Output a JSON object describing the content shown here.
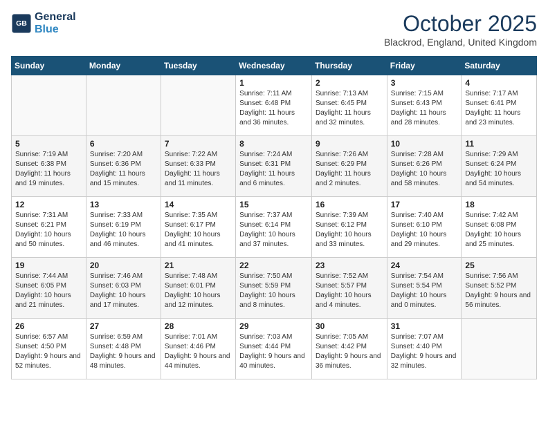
{
  "header": {
    "logo_line1": "General",
    "logo_line2": "Blue",
    "month": "October 2025",
    "location": "Blackrod, England, United Kingdom"
  },
  "days_of_week": [
    "Sunday",
    "Monday",
    "Tuesday",
    "Wednesday",
    "Thursday",
    "Friday",
    "Saturday"
  ],
  "weeks": [
    [
      {
        "num": "",
        "info": ""
      },
      {
        "num": "",
        "info": ""
      },
      {
        "num": "",
        "info": ""
      },
      {
        "num": "1",
        "info": "Sunrise: 7:11 AM\nSunset: 6:48 PM\nDaylight: 11 hours and 36 minutes."
      },
      {
        "num": "2",
        "info": "Sunrise: 7:13 AM\nSunset: 6:45 PM\nDaylight: 11 hours and 32 minutes."
      },
      {
        "num": "3",
        "info": "Sunrise: 7:15 AM\nSunset: 6:43 PM\nDaylight: 11 hours and 28 minutes."
      },
      {
        "num": "4",
        "info": "Sunrise: 7:17 AM\nSunset: 6:41 PM\nDaylight: 11 hours and 23 minutes."
      }
    ],
    [
      {
        "num": "5",
        "info": "Sunrise: 7:19 AM\nSunset: 6:38 PM\nDaylight: 11 hours and 19 minutes."
      },
      {
        "num": "6",
        "info": "Sunrise: 7:20 AM\nSunset: 6:36 PM\nDaylight: 11 hours and 15 minutes."
      },
      {
        "num": "7",
        "info": "Sunrise: 7:22 AM\nSunset: 6:33 PM\nDaylight: 11 hours and 11 minutes."
      },
      {
        "num": "8",
        "info": "Sunrise: 7:24 AM\nSunset: 6:31 PM\nDaylight: 11 hours and 6 minutes."
      },
      {
        "num": "9",
        "info": "Sunrise: 7:26 AM\nSunset: 6:29 PM\nDaylight: 11 hours and 2 minutes."
      },
      {
        "num": "10",
        "info": "Sunrise: 7:28 AM\nSunset: 6:26 PM\nDaylight: 10 hours and 58 minutes."
      },
      {
        "num": "11",
        "info": "Sunrise: 7:29 AM\nSunset: 6:24 PM\nDaylight: 10 hours and 54 minutes."
      }
    ],
    [
      {
        "num": "12",
        "info": "Sunrise: 7:31 AM\nSunset: 6:21 PM\nDaylight: 10 hours and 50 minutes."
      },
      {
        "num": "13",
        "info": "Sunrise: 7:33 AM\nSunset: 6:19 PM\nDaylight: 10 hours and 46 minutes."
      },
      {
        "num": "14",
        "info": "Sunrise: 7:35 AM\nSunset: 6:17 PM\nDaylight: 10 hours and 41 minutes."
      },
      {
        "num": "15",
        "info": "Sunrise: 7:37 AM\nSunset: 6:14 PM\nDaylight: 10 hours and 37 minutes."
      },
      {
        "num": "16",
        "info": "Sunrise: 7:39 AM\nSunset: 6:12 PM\nDaylight: 10 hours and 33 minutes."
      },
      {
        "num": "17",
        "info": "Sunrise: 7:40 AM\nSunset: 6:10 PM\nDaylight: 10 hours and 29 minutes."
      },
      {
        "num": "18",
        "info": "Sunrise: 7:42 AM\nSunset: 6:08 PM\nDaylight: 10 hours and 25 minutes."
      }
    ],
    [
      {
        "num": "19",
        "info": "Sunrise: 7:44 AM\nSunset: 6:05 PM\nDaylight: 10 hours and 21 minutes."
      },
      {
        "num": "20",
        "info": "Sunrise: 7:46 AM\nSunset: 6:03 PM\nDaylight: 10 hours and 17 minutes."
      },
      {
        "num": "21",
        "info": "Sunrise: 7:48 AM\nSunset: 6:01 PM\nDaylight: 10 hours and 12 minutes."
      },
      {
        "num": "22",
        "info": "Sunrise: 7:50 AM\nSunset: 5:59 PM\nDaylight: 10 hours and 8 minutes."
      },
      {
        "num": "23",
        "info": "Sunrise: 7:52 AM\nSunset: 5:57 PM\nDaylight: 10 hours and 4 minutes."
      },
      {
        "num": "24",
        "info": "Sunrise: 7:54 AM\nSunset: 5:54 PM\nDaylight: 10 hours and 0 minutes."
      },
      {
        "num": "25",
        "info": "Sunrise: 7:56 AM\nSunset: 5:52 PM\nDaylight: 9 hours and 56 minutes."
      }
    ],
    [
      {
        "num": "26",
        "info": "Sunrise: 6:57 AM\nSunset: 4:50 PM\nDaylight: 9 hours and 52 minutes."
      },
      {
        "num": "27",
        "info": "Sunrise: 6:59 AM\nSunset: 4:48 PM\nDaylight: 9 hours and 48 minutes."
      },
      {
        "num": "28",
        "info": "Sunrise: 7:01 AM\nSunset: 4:46 PM\nDaylight: 9 hours and 44 minutes."
      },
      {
        "num": "29",
        "info": "Sunrise: 7:03 AM\nSunset: 4:44 PM\nDaylight: 9 hours and 40 minutes."
      },
      {
        "num": "30",
        "info": "Sunrise: 7:05 AM\nSunset: 4:42 PM\nDaylight: 9 hours and 36 minutes."
      },
      {
        "num": "31",
        "info": "Sunrise: 7:07 AM\nSunset: 4:40 PM\nDaylight: 9 hours and 32 minutes."
      },
      {
        "num": "",
        "info": ""
      }
    ]
  ]
}
